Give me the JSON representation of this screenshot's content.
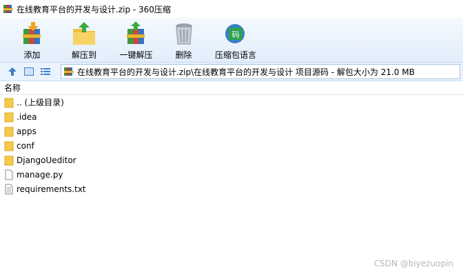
{
  "window": {
    "title": "在线教育平台的开发与设计.zip - 360压缩",
    "app_icon": "archive-icon"
  },
  "toolbar": {
    "items": [
      {
        "label": "添加",
        "icon": "add-books-icon"
      },
      {
        "label": "解压到",
        "icon": "extract-folder-icon"
      },
      {
        "label": "一键解压",
        "icon": "one-click-extract-icon"
      },
      {
        "label": "删除",
        "icon": "trash-can-icon"
      },
      {
        "label": "压缩包语言",
        "icon": "language-code-icon"
      }
    ]
  },
  "address": {
    "path": "在线教育平台的开发与设计.zip\\在线教育平台的开发与设计 项目源码 - 解包大小为 21.0 MB"
  },
  "list": {
    "column_name": "名称",
    "items": [
      {
        "name": ".. (上级目录)",
        "type": "folder"
      },
      {
        "name": ".idea",
        "type": "folder"
      },
      {
        "name": "apps",
        "type": "folder"
      },
      {
        "name": "conf",
        "type": "folder"
      },
      {
        "name": "DjangoUeditor",
        "type": "folder"
      },
      {
        "name": "manage.py",
        "type": "file"
      },
      {
        "name": "requirements.txt",
        "type": "textfile"
      }
    ]
  },
  "watermark": "CSDN @biyezuopin",
  "colors": {
    "toolbar_bg": "#e2eefb",
    "folder_yellow": "#f5c94a",
    "accent_blue": "#3a7dc9"
  }
}
